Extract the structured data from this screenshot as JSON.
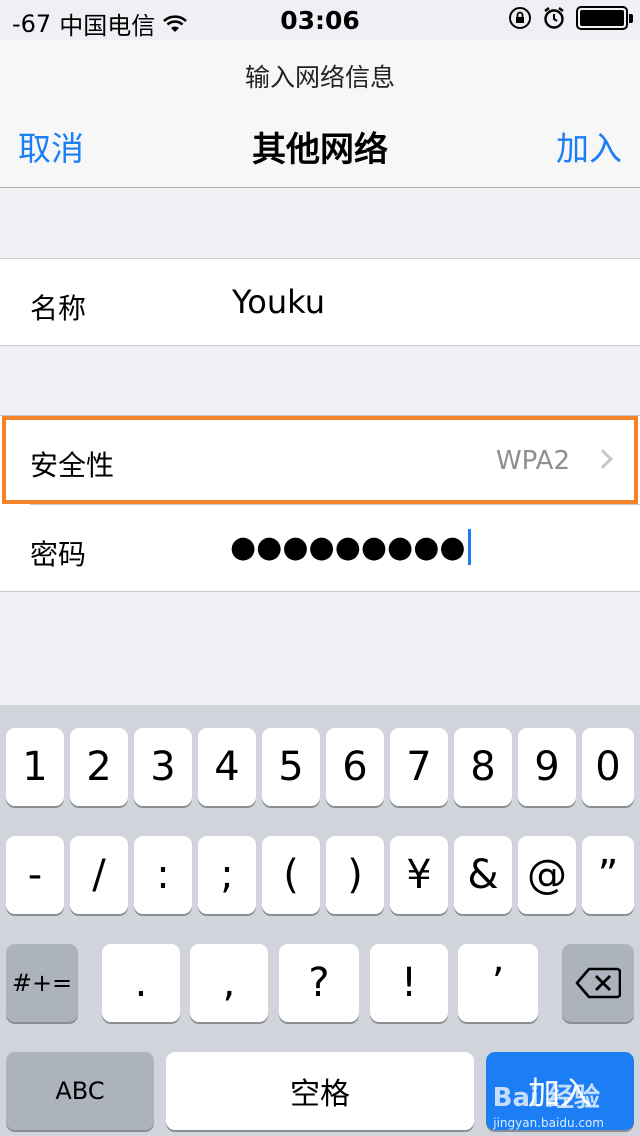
{
  "status_bar": {
    "signal": "-67",
    "carrier": "中国电信",
    "time": "03:06"
  },
  "nav": {
    "prompt": "输入网络信息",
    "cancel_label": "取消",
    "title": "其他网络",
    "join_label": "加入"
  },
  "form": {
    "name_label": "名称",
    "name_value": "Youku",
    "security_label": "安全性",
    "security_value": "WPA2",
    "password_label": "密码",
    "password_masked": "●●●●●●●●●"
  },
  "keyboard": {
    "row1": [
      "1",
      "2",
      "3",
      "4",
      "5",
      "6",
      "7",
      "8",
      "9",
      "0"
    ],
    "row2": [
      "-",
      "/",
      ":",
      ";",
      "(",
      ")",
      "¥",
      "&",
      "@",
      "”"
    ],
    "row3_shift": "#+=",
    "row3": [
      ".",
      ",",
      "?",
      "!",
      "’"
    ],
    "abc_label": "ABC",
    "space_label": "空格",
    "join_label": "加入"
  },
  "watermark": {
    "brand": "Bai 经验",
    "url": "jingyan.baidu.com"
  },
  "colors": {
    "accent": "#1b7ef5",
    "highlight": "#f5822a",
    "background": "#efeff4"
  }
}
